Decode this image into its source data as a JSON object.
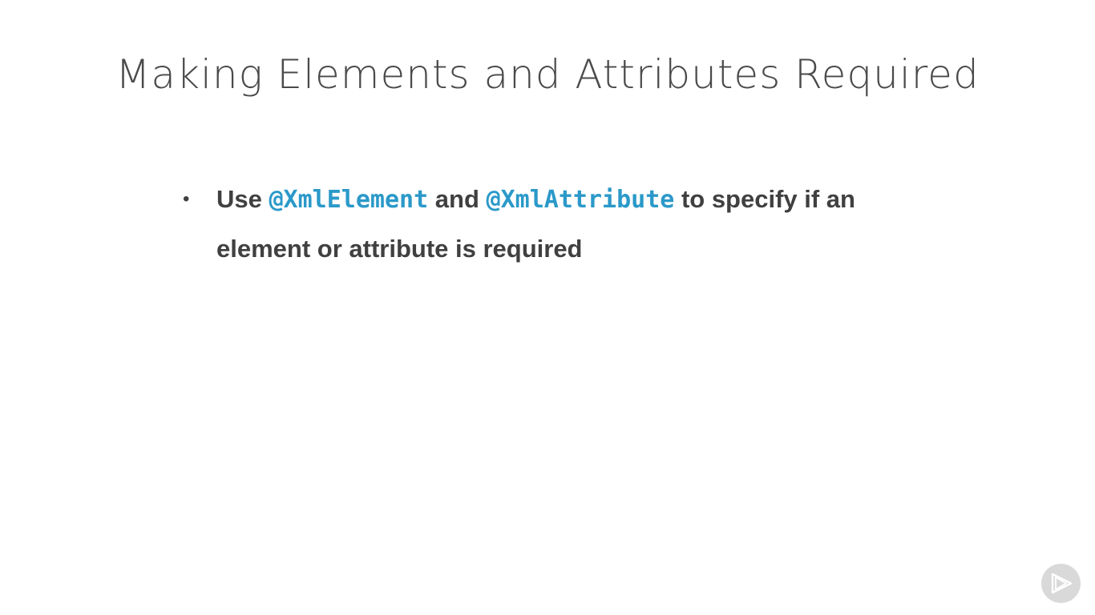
{
  "slide": {
    "title": "Making Elements and Attributes Required",
    "bullets": [
      {
        "bullet_glyph": "•",
        "text_before": "Use ",
        "code_1": "@XmlElement",
        "text_middle": " and ",
        "code_2": "@XmlAttribute",
        "text_after": " to specify if an element or attribute is required"
      }
    ]
  },
  "badge": {
    "icon": "play-logo-icon"
  },
  "colors": {
    "title": "#4a4a4a",
    "body_text": "#404040",
    "code_accent": "#2b99c9",
    "badge_background": "#d9d9d9"
  }
}
